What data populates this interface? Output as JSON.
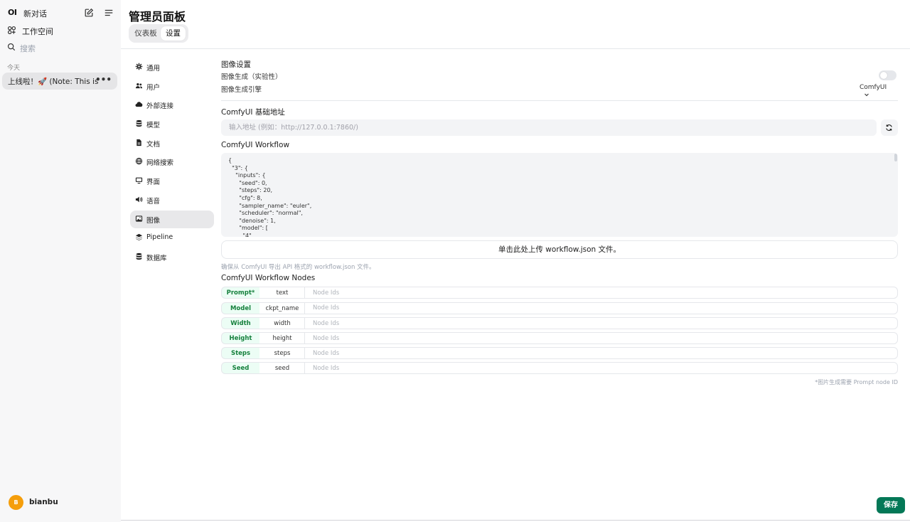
{
  "sidebar": {
    "logo": "OI",
    "new_chat": "新对话",
    "workspace": "工作空间",
    "search_placeholder": "搜索",
    "today": "今天",
    "chats": [
      {
        "title": "上线啦！🚀 (Note: This is a test"
      }
    ],
    "user": {
      "initial": "B",
      "name": "bianbu"
    }
  },
  "header": {
    "title": "管理员面板",
    "tabs": [
      {
        "label": "仪表板",
        "active": false
      },
      {
        "label": "设置",
        "active": true
      }
    ]
  },
  "settings_nav": {
    "items": [
      {
        "label": "通用",
        "icon": "gear-icon",
        "active": false
      },
      {
        "label": "用户",
        "icon": "users-icon",
        "active": false
      },
      {
        "label": "外部连接",
        "icon": "cloud-icon",
        "active": false
      },
      {
        "label": "模型",
        "icon": "database-icon",
        "active": false
      },
      {
        "label": "文档",
        "icon": "document-icon",
        "active": false
      },
      {
        "label": "网络搜索",
        "icon": "globe-icon",
        "active": false
      },
      {
        "label": "界面",
        "icon": "monitor-icon",
        "active": false
      },
      {
        "label": "语音",
        "icon": "speaker-icon",
        "active": false
      },
      {
        "label": "图像",
        "icon": "image-icon",
        "active": true
      },
      {
        "label": "Pipeline",
        "icon": "layers-icon",
        "active": false
      },
      {
        "label": "数据库",
        "icon": "database-icon",
        "active": false
      }
    ]
  },
  "image_settings": {
    "heading": "图像设置",
    "generation_label": "图像生成（实验性）",
    "generation_enabled": false,
    "engine_label": "图像生成引擎",
    "engine_value": "ComfyUI",
    "base_url_label": "ComfyUI 基础地址",
    "base_url_placeholder": "输入地址 (例如：http://127.0.0.1:7860/)",
    "base_url_value": "",
    "workflow_label": "ComfyUI Workflow",
    "workflow_json": "{\n  \"3\": {\n    \"inputs\": {\n      \"seed\": 0,\n      \"steps\": 20,\n      \"cfg\": 8,\n      \"sampler_name\": \"euler\",\n      \"scheduler\": \"normal\",\n      \"denoise\": 1,\n      \"model\": [\n        \"4\"",
    "upload_label": "单击此处上传 workflow.json 文件。",
    "export_hint": "确保从 ComfyUI 导出 API 格式的 workflow.json 文件。",
    "nodes_label": "ComfyUI Workflow Nodes",
    "nodes": [
      {
        "type": "Prompt*",
        "key": "text",
        "placeholder": "Node Ids",
        "value": ""
      },
      {
        "type": "Model",
        "key": "ckpt_name",
        "placeholder": "Node Ids",
        "value": ""
      },
      {
        "type": "Width",
        "key": "width",
        "placeholder": "Node Ids",
        "value": ""
      },
      {
        "type": "Height",
        "key": "height",
        "placeholder": "Node Ids",
        "value": ""
      },
      {
        "type": "Steps",
        "key": "steps",
        "placeholder": "Node Ids",
        "value": ""
      },
      {
        "type": "Seed",
        "key": "seed",
        "placeholder": "Node Ids",
        "value": ""
      }
    ],
    "prompt_note": "*图片生成需要 Prompt node ID"
  },
  "footer": {
    "save_label": "保存"
  },
  "colors": {
    "accent": "#047857",
    "node_tag_bg": "#ecfdf5",
    "node_tag_text": "#16803d",
    "avatar": "#f59e0b"
  }
}
